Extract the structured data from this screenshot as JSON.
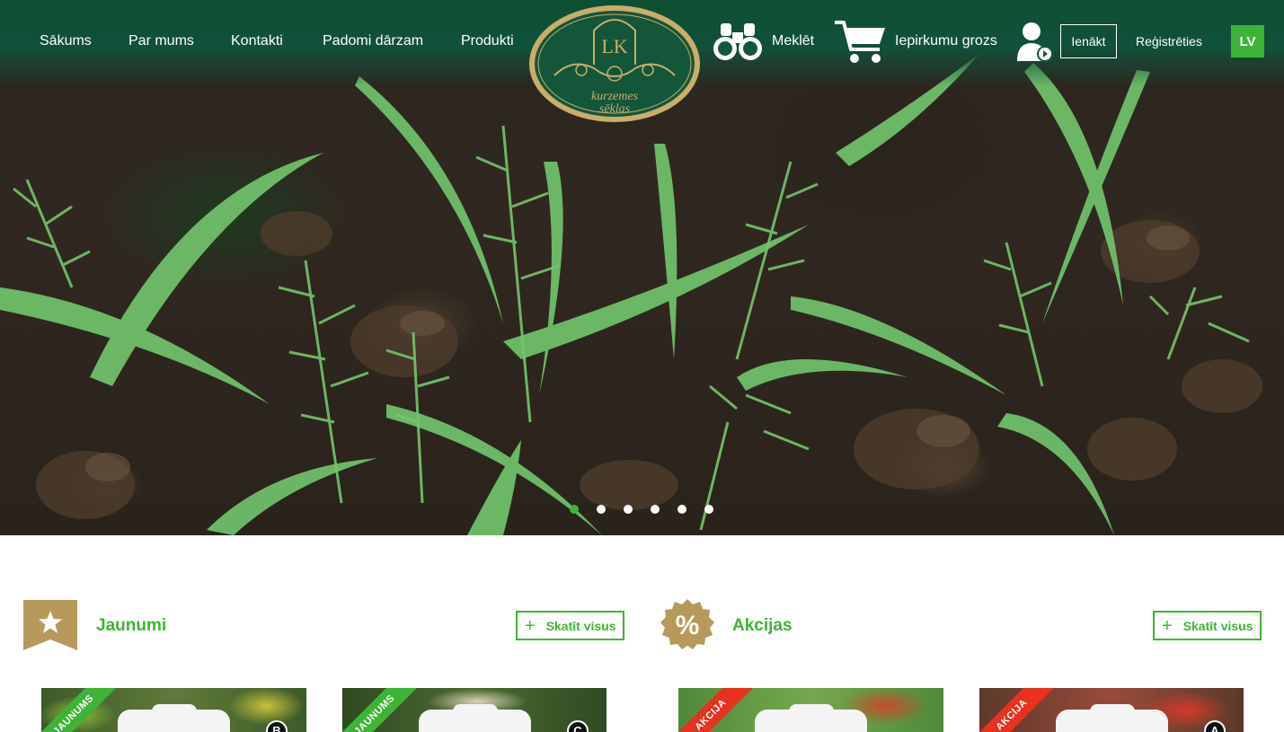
{
  "nav": {
    "links": [
      "Sākums",
      "Par mums",
      "Kontakti",
      "Padomi dārzam",
      "Produkti"
    ],
    "search_label": "Meklēt",
    "cart_label": "Iepirkumu grozs",
    "login_label": "Ienākt",
    "register_label": "Reģistrēties",
    "language": "LV"
  },
  "logo": {
    "line1": "kurzemes",
    "line2": "sēklas",
    "monogram": "LK"
  },
  "slider": {
    "slide_count": 6,
    "active_index": 0
  },
  "sections": {
    "new": {
      "title": "Jaunumi",
      "view_all": "Skatīt visus",
      "icon": "star-icon"
    },
    "sale": {
      "title": "Akcijas",
      "view_all": "Skatīt visus",
      "icon": "percent-icon",
      "icon_text": "%"
    }
  },
  "products": [
    {
      "ribbon": "JAUNUMS",
      "ribbon_color": "#3fb337",
      "grade": "B"
    },
    {
      "ribbon": "JAUNUMS",
      "ribbon_color": "#3fb337",
      "grade": "C"
    },
    {
      "ribbon": "AKCIJA",
      "ribbon_color": "#e8311e",
      "grade": ""
    },
    {
      "ribbon": "AKCIJA",
      "ribbon_color": "#e8311e",
      "grade": "A"
    }
  ],
  "colors": {
    "brand_green": "#3fb337",
    "header_green": "#0e4f33",
    "gold": "#b79a5b"
  }
}
